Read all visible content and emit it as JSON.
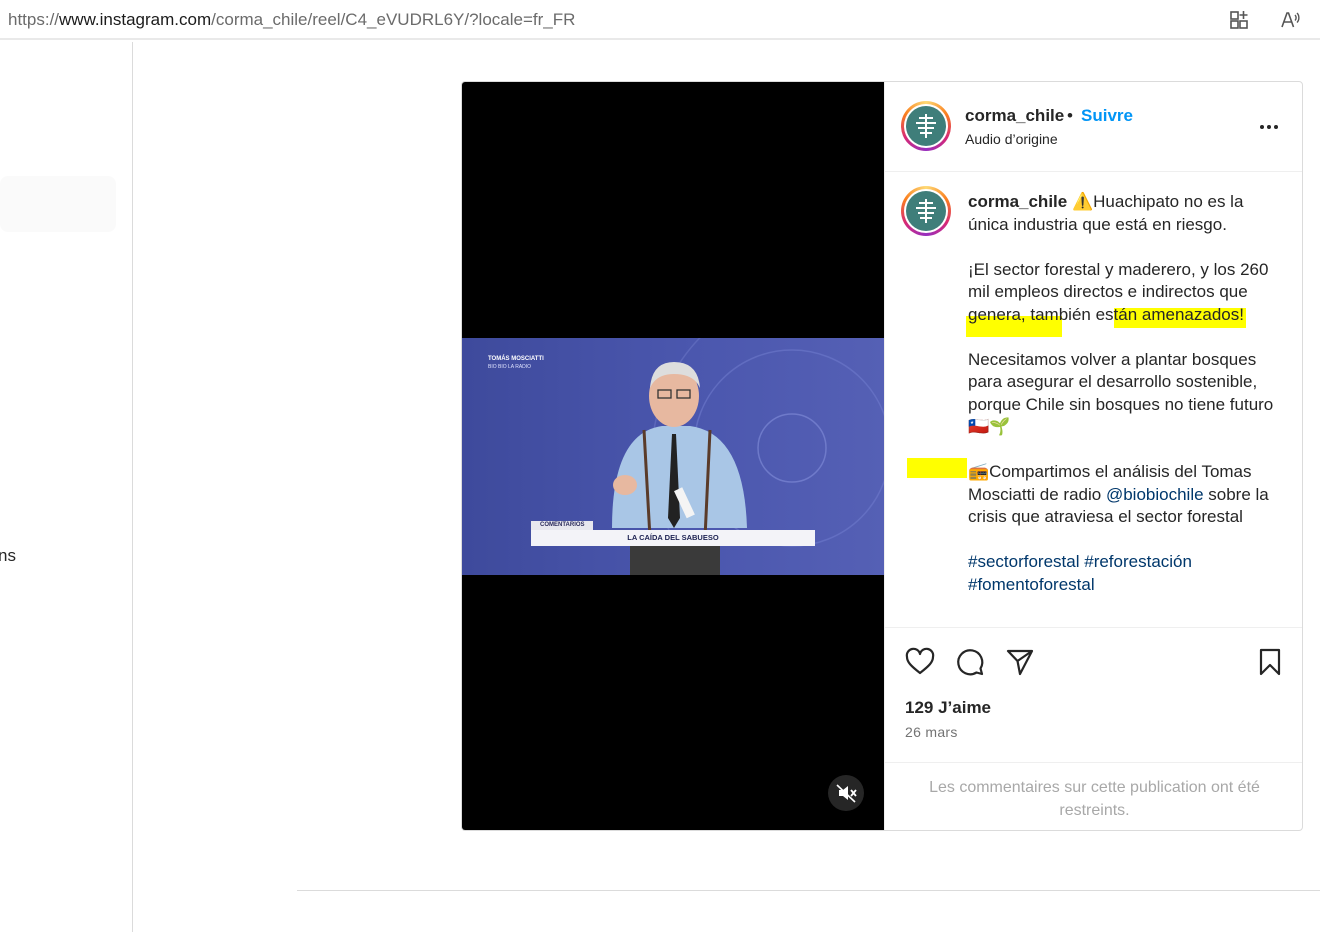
{
  "browser": {
    "url_prefix": "https://",
    "url_host": "www.instagram.com",
    "url_path": "/corma_chile/reel/C4_eVUDRL6Y/?locale=fr_FR",
    "icons": [
      "add-tab-icon",
      "read-aloud-icon"
    ]
  },
  "left_nav": {
    "partial_label": "ns"
  },
  "post": {
    "header": {
      "username": "corma_chile",
      "separator": "•",
      "follow_label": "Suivre",
      "audio_label": "Audio d’origine"
    },
    "video": {
      "lower_third_name": "TOMÁS MOSCIATTI",
      "lower_third_outlet": "BIO BIO LA RADIO",
      "banner_tag": "COMENTARIOS",
      "banner_title": "LA CAÍDA DEL SABUESO",
      "mute_icon": "speaker-muted-icon"
    },
    "caption": {
      "username": "corma_chile",
      "line1": "⚠️Huachipato no es la única industria que está en riesgo.",
      "para2": "¡El sector forestal y maderero, y los 260 mil empleos directos e indirectos que genera, también están amenazados!",
      "para3": "Necesitamos volver a plantar bosques para asegurar el desarrollo sostenible, porque Chile sin bosques no tiene futuro 🇨🇱🌱",
      "para4_prefix": "📻Compartimos el análisis del Tomas Mosciatti de radio ",
      "mention": "@biobiochile",
      "para4_suffix": " sobre la crisis que atraviesa el sector forestal",
      "hashtags": [
        "#sectorforestal",
        "#reforestación",
        "#fomentoforestal"
      ]
    },
    "actions": {
      "icons": [
        "heart-icon",
        "comment-icon",
        "share-icon",
        "bookmark-icon"
      ],
      "likes": "129 J’aime",
      "date": "26 mars",
      "comments_restricted": "Les commentaires sur cette publication ont été restreints."
    }
  },
  "colors": {
    "follow_blue": "#0095f6",
    "link_blue": "#00376b",
    "highlight_yellow": "#ffff00",
    "avatar_teal": "#3f7e7a",
    "border": "#dbdbdb"
  }
}
